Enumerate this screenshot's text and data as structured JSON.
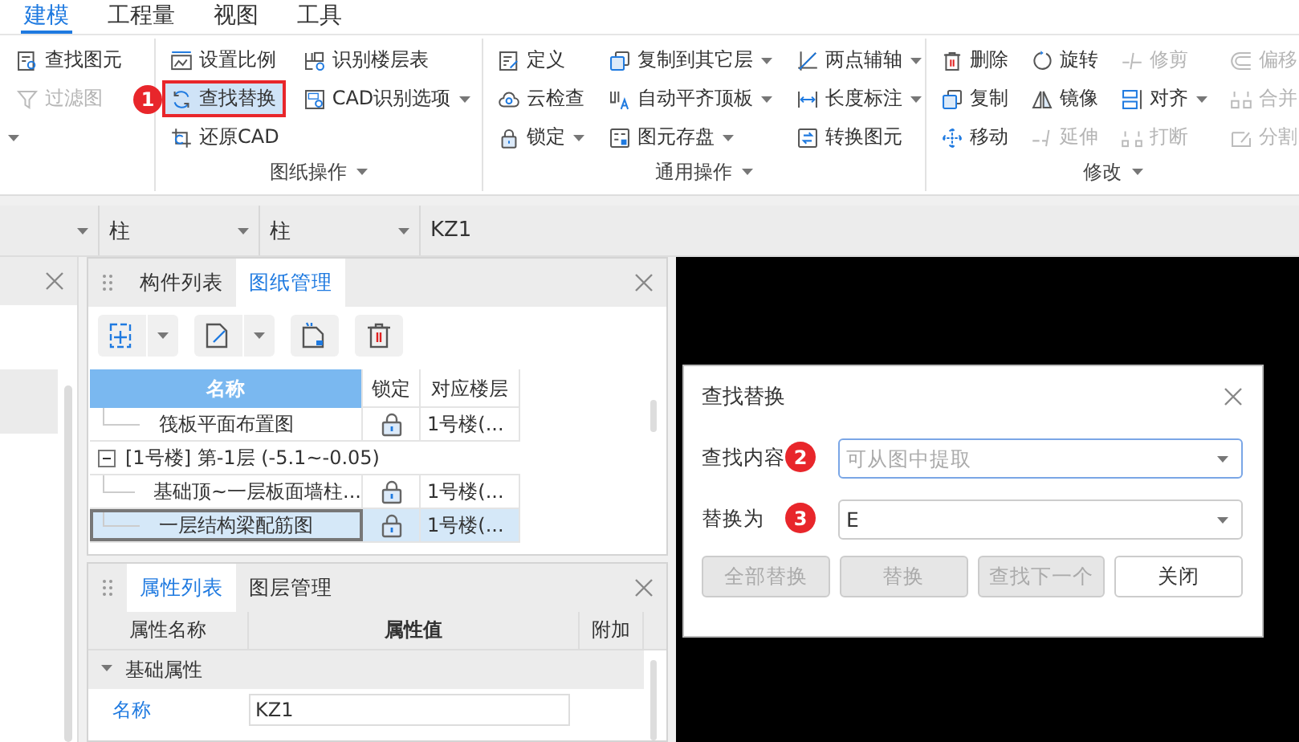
{
  "menu_tabs": [
    {
      "label": "建模",
      "selected": true
    },
    {
      "label": "工程量",
      "selected": false
    },
    {
      "label": "视图",
      "selected": false
    },
    {
      "label": "工具",
      "selected": false
    }
  ],
  "ribbon_groups": [
    {
      "menu_caret": true,
      "columns": [
        [
          {
            "label": "查找图元",
            "disabled": false,
            "selected": false,
            "dropdown": false
          },
          {
            "label": "过滤图",
            "disabled": true,
            "selected": false,
            "dropdown": false
          }
        ]
      ]
    },
    {
      "label": "图纸操作",
      "columns": [
        [
          {
            "label": "设置比例",
            "disabled": false,
            "selected": false,
            "dropdown": false
          },
          {
            "label": "查找替换",
            "disabled": false,
            "selected": true,
            "dropdown": false,
            "boxed": true,
            "badge": "1"
          },
          {
            "label": "还原CAD",
            "disabled": false,
            "selected": false,
            "dropdown": false
          }
        ],
        [
          {
            "label": "识别楼层表",
            "disabled": false,
            "selected": false,
            "dropdown": false
          },
          {
            "label": "CAD识别选项",
            "disabled": false,
            "selected": false,
            "dropdown": true
          }
        ]
      ]
    },
    {
      "label": "通用操作",
      "columns": [
        [
          {
            "label": "定义",
            "disabled": false,
            "selected": false,
            "dropdown": false
          },
          {
            "label": "云检查",
            "disabled": false,
            "selected": false,
            "dropdown": false
          },
          {
            "label": "锁定",
            "disabled": false,
            "selected": false,
            "dropdown": true
          }
        ],
        [
          {
            "label": "复制到其它层",
            "disabled": false,
            "selected": false,
            "dropdown": true
          },
          {
            "label": "自动平齐顶板",
            "disabled": false,
            "selected": false,
            "dropdown": true
          },
          {
            "label": "图元存盘",
            "disabled": false,
            "selected": false,
            "dropdown": true
          }
        ],
        [
          {
            "label": "两点辅轴",
            "disabled": false,
            "selected": false,
            "dropdown": true
          },
          {
            "label": "长度标注",
            "disabled": false,
            "selected": false,
            "dropdown": true
          },
          {
            "label": "转换图元",
            "disabled": false,
            "selected": false,
            "dropdown": false
          }
        ]
      ]
    },
    {
      "label": "修改",
      "columns": [
        [
          {
            "label": "删除",
            "disabled": false,
            "selected": false,
            "dropdown": false
          },
          {
            "label": "复制",
            "disabled": false,
            "selected": false,
            "dropdown": false
          },
          {
            "label": "移动",
            "disabled": false,
            "selected": false,
            "dropdown": false
          }
        ],
        [
          {
            "label": "旋转",
            "disabled": false,
            "selected": false,
            "dropdown": false
          },
          {
            "label": "镜像",
            "disabled": false,
            "selected": false,
            "dropdown": false
          },
          {
            "label": "延伸",
            "disabled": true,
            "selected": false,
            "dropdown": false
          }
        ],
        [
          {
            "label": "修剪",
            "disabled": true,
            "selected": false,
            "dropdown": false
          },
          {
            "label": "对齐",
            "disabled": false,
            "selected": false,
            "dropdown": true
          },
          {
            "label": "打断",
            "disabled": true,
            "selected": false,
            "dropdown": false
          }
        ],
        [
          {
            "label": "偏移",
            "disabled": true,
            "selected": false,
            "dropdown": false
          },
          {
            "label": "合并",
            "disabled": true,
            "selected": false,
            "dropdown": false
          },
          {
            "label": "分割",
            "disabled": true,
            "selected": false,
            "dropdown": false
          }
        ]
      ]
    }
  ],
  "selector_bar": [
    {
      "caret": true
    },
    {
      "value": "柱",
      "caret": true
    },
    {
      "value": "柱",
      "caret": true
    },
    {
      "value": "KZ1",
      "caret": false
    }
  ],
  "drawing_panel": {
    "tabs": [
      {
        "label": "构件列表",
        "selected": false
      },
      {
        "label": "图纸管理",
        "selected": true
      }
    ],
    "columns": [
      "名称",
      "锁定",
      "对应楼层"
    ],
    "rows": [
      {
        "kind": "leaf",
        "name": "筏板平面布置图",
        "floor": "1号楼(...",
        "selected": false
      },
      {
        "kind": "group",
        "name": "[1号楼] 第-1层 (-5.1~-0.05)",
        "expanded": true,
        "children": [
          {
            "kind": "leaf",
            "name": "基础顶~一层板面墙柱...",
            "floor": "1号楼(...",
            "selected": false
          },
          {
            "kind": "leaf",
            "name": "一层结构梁配筋图",
            "floor": "1号楼(...",
            "selected": true
          }
        ]
      }
    ]
  },
  "property_panel": {
    "tabs": [
      {
        "label": "属性列表",
        "selected": true
      },
      {
        "label": "图层管理",
        "selected": false
      }
    ],
    "columns": [
      "属性名称",
      "属性值",
      "附加"
    ],
    "groups": [
      {
        "name": "基础属性",
        "expanded": true,
        "rows": [
          {
            "name": "名称",
            "value": "KZ1"
          }
        ]
      }
    ]
  },
  "dialog": {
    "title": "查找替换",
    "fields": [
      {
        "label": "查找内容",
        "badge": "2",
        "placeholder": "可从图中提取",
        "focused": true
      },
      {
        "label": "替换为",
        "badge": "3",
        "value": "E",
        "focused": false
      }
    ],
    "buttons": [
      {
        "label": "全部替换",
        "disabled": true
      },
      {
        "label": "替换",
        "disabled": true
      },
      {
        "label": "查找下一个",
        "disabled": true
      },
      {
        "label": "关闭",
        "disabled": false
      }
    ]
  }
}
